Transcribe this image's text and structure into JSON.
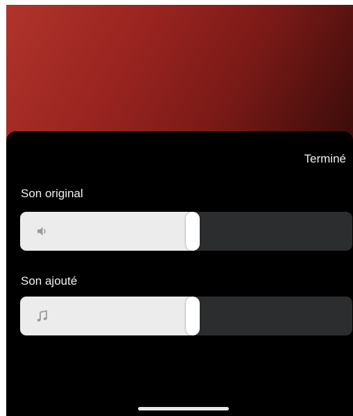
{
  "header": {
    "done_label": "Terminé"
  },
  "original_sound": {
    "label": "Son original",
    "icon": "speaker-icon",
    "level": 0.52
  },
  "added_sound": {
    "label": "Son ajouté",
    "icon": "music-note-icon",
    "level": 0.52
  },
  "colors": {
    "background": "#000000",
    "slider_fill": "#ececec",
    "slider_track": "#2b2d2e",
    "text": "#f2f2f2",
    "preview_red": "#9a2420"
  }
}
